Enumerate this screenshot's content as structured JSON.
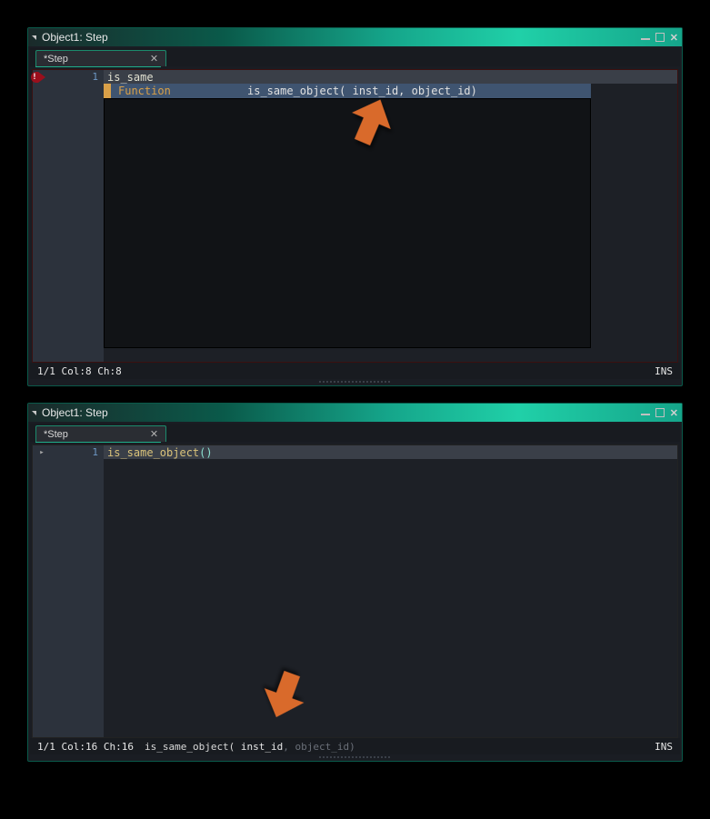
{
  "window1": {
    "title": "Object1: Step",
    "tab": "*Step",
    "gutter": {
      "line": "1"
    },
    "code_text": "is_same",
    "autocomplete": {
      "kind": "Function",
      "signature": "is_same_object( inst_id, object_id)"
    },
    "status": {
      "pos": "1/1 Col:8 Ch:8",
      "ins": "INS"
    }
  },
  "window2": {
    "title": "Object1: Step",
    "tab": "*Step",
    "gutter": {
      "line": "1",
      "chevron": "▸"
    },
    "code": {
      "fn": "is_same_object",
      "paren": "()"
    },
    "status": {
      "pos": "1/1 Col:16 Ch:16",
      "fn": "is_same_object(",
      "current_arg": " inst_id",
      "sep": ", ",
      "rest_arg": "object_id)",
      "ins": "INS"
    }
  }
}
